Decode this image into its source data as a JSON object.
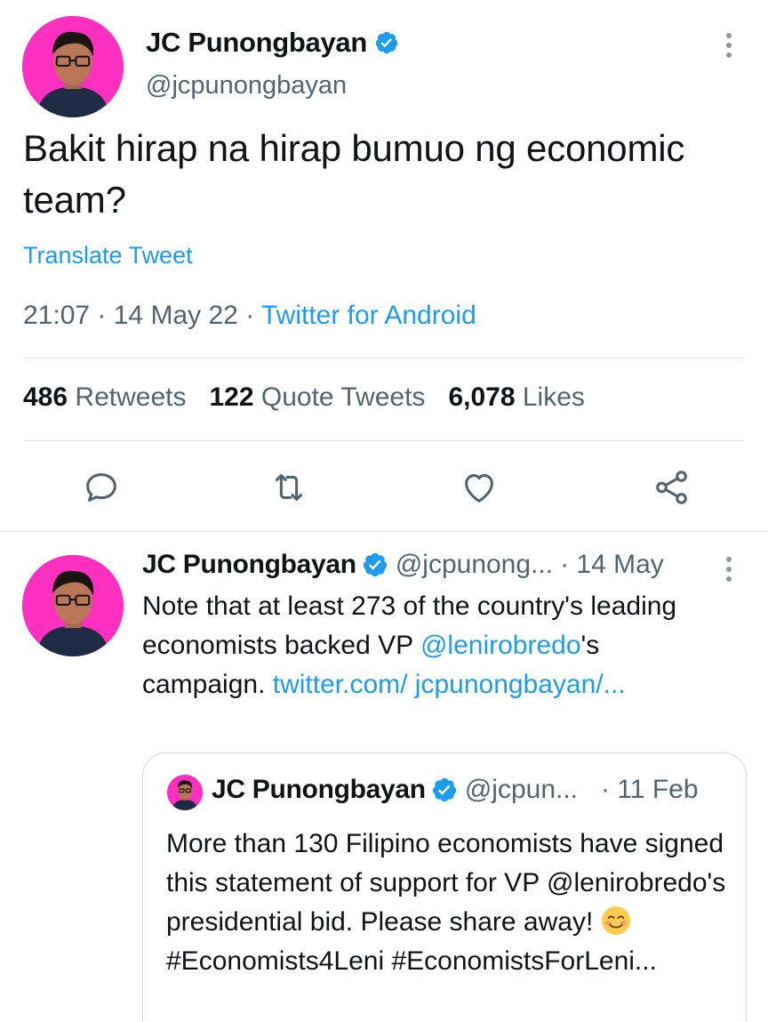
{
  "colors": {
    "accent": "#1d9bf0",
    "secondary_text": "#536471",
    "avatar_bg": "#ff2fbf"
  },
  "main_tweet": {
    "author_name": "JC Punongbayan",
    "author_handle": "@jcpunongbayan",
    "verified": true,
    "text": "Bakit hirap na hirap bumuo ng economic team?",
    "translate_label": "Translate Tweet",
    "time": "21:07",
    "date": "14 May 22",
    "source": "Twitter for Android",
    "stats": {
      "retweets_count": "486",
      "retweets_label": "Retweets",
      "quotes_count": "122",
      "quotes_label": "Quote Tweets",
      "likes_count": "6,078",
      "likes_label": "Likes"
    },
    "actions": [
      "reply-icon",
      "retweet-icon",
      "like-icon",
      "share-icon"
    ]
  },
  "reply_tweet": {
    "author_name": "JC Punongbayan",
    "author_handle": "@jcpunong...",
    "time": "· 14 May",
    "text_before_mention": "Note that at least 273 of the country's leading economists backed VP ",
    "mention": "@lenirobredo",
    "text_after_mention": "'s campaign. ",
    "link_text": "twitter.com/ jcpunongbayan/..."
  },
  "quoted_tweet": {
    "author_name": "JC Punongbayan",
    "author_handle": "@jcpun...",
    "time": "· 11 Feb",
    "text_part1": "More than 130 Filipino economists have signed this statement of support for VP @lenirobredo's presidential bid. Please share away! ",
    "emoji": "smiling-face-emoji",
    "text_part2": " #Economists4Leni #EconomistsForLeni..."
  }
}
